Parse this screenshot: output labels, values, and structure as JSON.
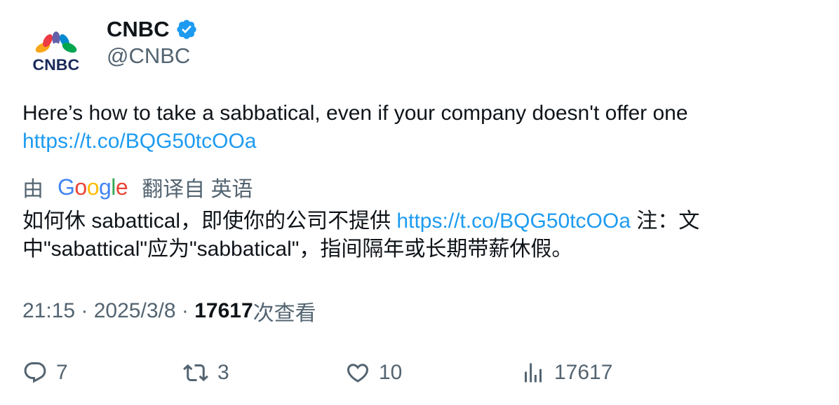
{
  "author": {
    "name": "CNBC",
    "handle": "@CNBC",
    "avatar_text": "CNBC",
    "verified": true,
    "verified_color": "#1d9bf0"
  },
  "tweet": {
    "text": "Here’s how to take a sabbatical, even if your company doesn't offer one ",
    "link": "https://t.co/BQG50tcOOa"
  },
  "translation": {
    "prefix": "由",
    "provider": "Google",
    "suffix": "翻译自 英语",
    "text_before_link": "如何休 sabattical，即使你的公司不提供 ",
    "link": "https://t.co/BQG50tcOOa",
    "text_after_link": " 注：文中\"sabattical\"应为\"sabbatical\"，指间隔年或长期带薪休假。"
  },
  "meta": {
    "time": "21:15",
    "separator": " · ",
    "date": "2025/3/8",
    "views_count": "17617",
    "views_label": "次查看"
  },
  "actions": {
    "replies": "7",
    "reposts": "3",
    "likes": "10",
    "views": "17617"
  },
  "colors": {
    "link": "#1d9bf0",
    "secondary_text": "#536471",
    "primary_text": "#0f1419"
  }
}
